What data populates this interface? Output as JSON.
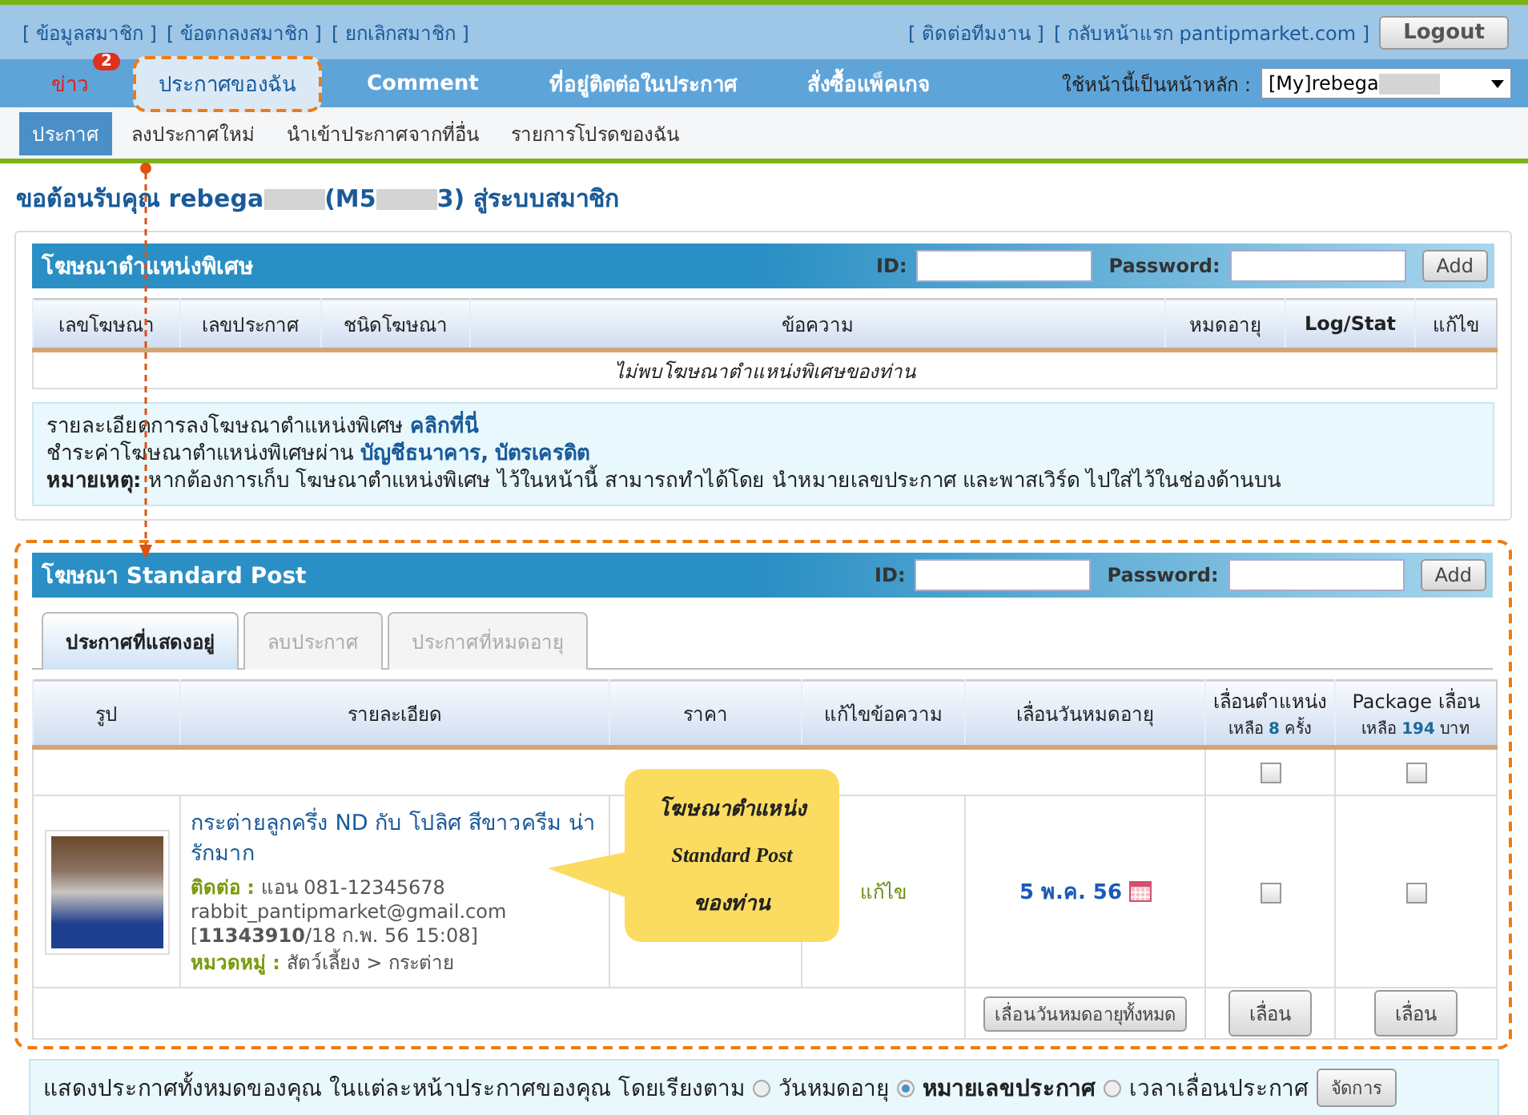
{
  "top_links_left": [
    "[ ข้อมูลสมาชิก ]",
    "[ ข้อตกลงสมาชิก ]",
    "[ ยกเลิกสมาชิก ]"
  ],
  "top_links_right": [
    "[ ติดต่อทีมงาน ]",
    "[ กลับหน้าแรก pantipmarket.com ]"
  ],
  "logout": "Logout",
  "nav": [
    {
      "label": "ข่าว",
      "badge": "2",
      "selected": false,
      "highlighted": false
    },
    {
      "label": "ประกาศของฉัน",
      "selected": true,
      "highlighted": true
    },
    {
      "label": "Comment",
      "selected": false,
      "highlighted": false
    },
    {
      "label": "ที่อยู่ติดต่อในประกาศ",
      "selected": false,
      "highlighted": false
    },
    {
      "label": "สั่งซื้อแพ็คเกจ",
      "selected": false,
      "highlighted": false
    }
  ],
  "home_select": {
    "label": "ใช้หน้านี้เป็นหน้าหลัก :",
    "value": "[My]rebega"
  },
  "subnav": [
    {
      "label": "ประกาศ",
      "selected": true
    },
    {
      "label": "ลงประกาศใหม่",
      "selected": false
    },
    {
      "label": "นำเข้าประกาศจากที่อื่น",
      "selected": false
    },
    {
      "label": "รายการโปรดของฉัน",
      "selected": false
    }
  ],
  "welcome": [
    "ขอต้อนรับคุณ rebega",
    "(M5",
    "3) สู่ระบบสมาชิก"
  ],
  "special": {
    "title": "โฆษณาตำแหน่งพิเศษ",
    "id_label": "ID:",
    "password_label": "Password:",
    "add": "Add",
    "columns": [
      "เลขโฆษณา",
      "เลขประกาศ",
      "ชนิดโฆษณา",
      "ข้อความ",
      "หมดอายุ",
      "Log/Stat",
      "แก้ไข"
    ],
    "empty_message": "ไม่พบโฆษณาตำแหน่งพิเศษของท่าน",
    "info": [
      {
        "text": "รายละเอียดการลงโฆษณาตำแหน่งพิเศษ",
        "links": [
          "คลิกที่นี่"
        ]
      },
      {
        "text": "ชำระค่าโฆษณาตำแหน่งพิเศษผ่าน",
        "links": [
          "บัญชีธนาคาร,",
          "บัตรเครดิต"
        ]
      },
      {
        "text": "**หมายเหตุ:** หากต้องการเก็บ โฆษณาตำแหน่งพิเศษ ไว้ในหน้านี้ สามารถทำได้โดย นำหมายเลขประกาศ และพาสเวิร์ด ไปใส่ไว้ในช่องด้านบน"
      }
    ]
  },
  "standard": {
    "title": "โฆษณา Standard Post",
    "id_label": "ID:",
    "password_label": "Password:",
    "add": "Add",
    "highlighted": true,
    "tabs": [
      {
        "label": "ประกาศที่แสดงอยู่",
        "selected": true
      },
      {
        "label": "ลบประกาศ",
        "selected": false
      },
      {
        "label": "ประกาศที่หมดอายุ",
        "selected": false
      }
    ],
    "columns": [
      {
        "label": "รูป"
      },
      {
        "label": "รายละเอียด"
      },
      {
        "label": "ราคา"
      },
      {
        "label": "แก้ไขข้อความ"
      },
      {
        "label": "เลื่อนวันหมดอายุ"
      },
      {
        "label": "เลื่อนตำแหน่ง",
        "sub": "เหลือ **8** ครั้ง"
      },
      {
        "label": "Package เลื่อน",
        "sub": "เหลือ **194** บาท"
      }
    ],
    "select_all": [
      {
        "checked": false
      },
      {
        "checked": false
      }
    ],
    "listing": {
      "title": "กระต่ายลูกครึ่ง ND กับ โปลิศ สีขาวครีม น่ารักมาก",
      "contact_label": "ติดต่อ :",
      "contact": "แอน 081-12345678",
      "email": "rabbit_pantipmarket@gmail.com",
      "ref": "[**11343910**/18 ก.พ. 56 15:08]",
      "category_label": "หมวดหมู่ :",
      "category": "สัตว์เลี้ยง > กระต่าย",
      "edit": "แก้ไข",
      "expiry": "5 พ.ค. 56",
      "bump": {
        "checked": false
      },
      "package": {
        "checked": false
      }
    },
    "footer_buttons": [
      "เลื่อนวันหมดอายุทั้งหมด",
      "เลื่อน",
      "เลื่อน"
    ],
    "callout": [
      "โฆษณาตำแหน่ง",
      "Standard Post",
      "ของท่าน"
    ]
  },
  "sort_bar": {
    "text": "แสดงประกาศทั้งหมดของคุณ ในแต่ละหน้าประกาศของคุณ โดยเรียงตาม",
    "options": [
      {
        "label": "วันหมดอายุ",
        "selected": false
      },
      {
        "label": "หมายเลขประกาศ",
        "selected": true
      },
      {
        "label": "เวลาเลื่อนประกาศ",
        "selected": false
      }
    ],
    "button": "จัดการ"
  }
}
